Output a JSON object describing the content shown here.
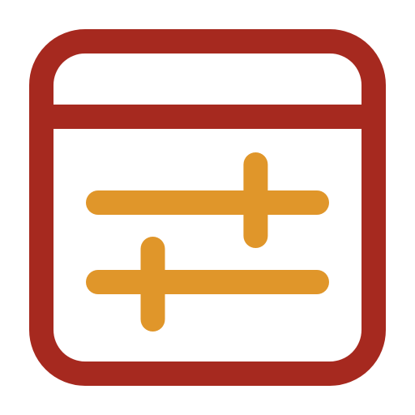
{
  "icon": {
    "name": "window-settings-sliders-icon",
    "colors": {
      "frame": "#A6291F",
      "sliders": "#E0962A",
      "background": "#FFFFFF"
    },
    "sliders": [
      {
        "name": "slider-top",
        "level": 0.72
      },
      {
        "name": "slider-bottom",
        "level": 0.25
      }
    ]
  }
}
